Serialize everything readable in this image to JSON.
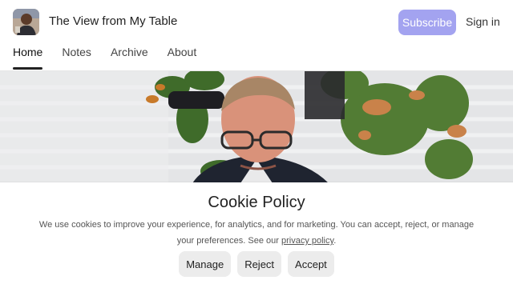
{
  "site": {
    "title": "The View from My Table",
    "subscribe_label": "Subscribe",
    "signin_label": "Sign in",
    "accent_color": "#a3a3f0"
  },
  "nav": {
    "items": [
      {
        "label": "Home",
        "active": true
      },
      {
        "label": "Notes",
        "active": false
      },
      {
        "label": "Archive",
        "active": false
      },
      {
        "label": "About",
        "active": false
      }
    ]
  },
  "cookie": {
    "title": "Cookie Policy",
    "text_before": "We use cookies to improve your experience, for analytics, and for marketing. You can accept, reject, or manage your preferences. See our ",
    "link_label": "privacy policy",
    "text_after": ".",
    "manage_label": "Manage",
    "reject_label": "Reject",
    "accept_label": "Accept"
  }
}
